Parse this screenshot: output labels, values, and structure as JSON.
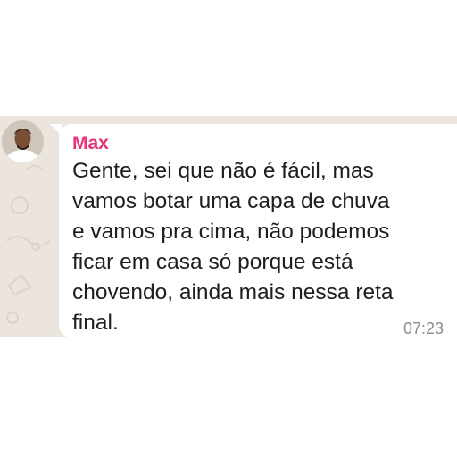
{
  "message": {
    "sender_name": "Max",
    "text_lines": [
      "Gente, sei que não é fácil, mas",
      "vamos botar uma capa de chuva",
      "e vamos pra cima, não podemos",
      "ficar em casa só porque está",
      "chovendo, ainda mais nessa reta",
      "final."
    ],
    "timestamp": "07:23"
  },
  "colors": {
    "sender_name": "#e8337a",
    "chat_background": "#ece5dd",
    "bubble": "#ffffff",
    "message_text": "#1e1e1e",
    "timestamp": "#8c8c8c"
  },
  "icons": {
    "avatar": "user-avatar-photo"
  }
}
